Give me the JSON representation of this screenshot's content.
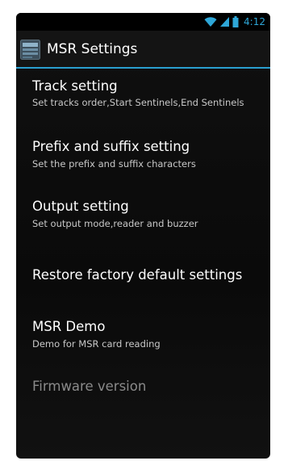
{
  "status_bar": {
    "time": "4:12",
    "icons": [
      "wifi-icon",
      "signal-icon",
      "battery-icon"
    ],
    "accent_color": "#2ea7d8"
  },
  "action_bar": {
    "title": "MSR Settings",
    "icon": "app-settings-icon",
    "divider_color": "#2a9fd0"
  },
  "settings": [
    {
      "title": "Track setting",
      "summary": "Set tracks order,Start Sentinels,End Sentinels",
      "enabled": true
    },
    {
      "title": "Prefix and suffix setting",
      "summary": "Set the prefix and suffix characters",
      "enabled": true
    },
    {
      "title": "Output setting",
      "summary": "Set output mode,reader and buzzer",
      "enabled": true
    },
    {
      "title": "Restore factory default settings",
      "summary": "",
      "enabled": true
    },
    {
      "title": "MSR Demo",
      "summary": "Demo for MSR card reading",
      "enabled": true
    },
    {
      "title": "Firmware version",
      "summary": "",
      "enabled": false
    }
  ]
}
